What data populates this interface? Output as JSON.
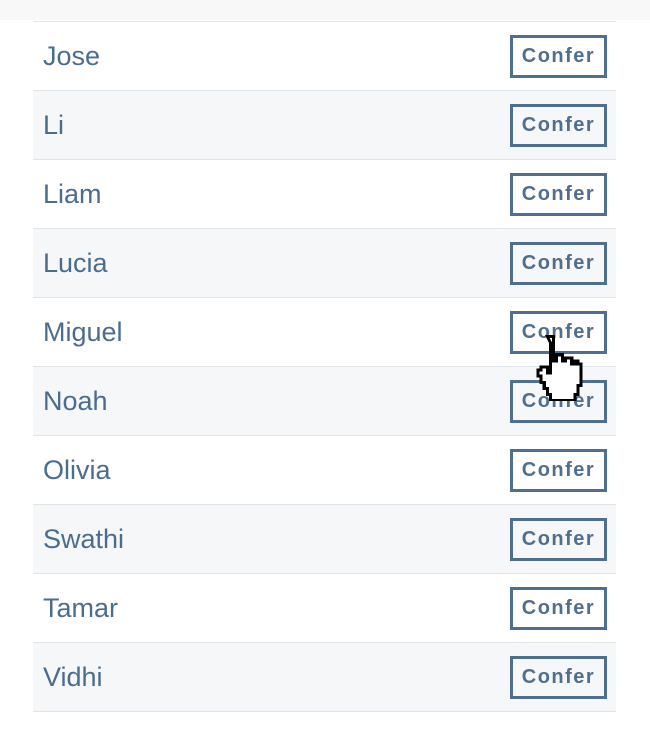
{
  "rows": [
    {
      "name": "Jose",
      "button": "Confer"
    },
    {
      "name": "Li",
      "button": "Confer"
    },
    {
      "name": "Liam",
      "button": "Confer"
    },
    {
      "name": "Lucia",
      "button": "Confer"
    },
    {
      "name": "Miguel",
      "button": "Confer"
    },
    {
      "name": "Noah",
      "button": "Confer"
    },
    {
      "name": "Olivia",
      "button": "Confer"
    },
    {
      "name": "Swathi",
      "button": "Confer"
    },
    {
      "name": "Tamar",
      "button": "Confer"
    },
    {
      "name": "Vidhi",
      "button": "Confer"
    }
  ],
  "colors": {
    "accent": "#4f6f8f",
    "text": "#4a6d8e",
    "row_alt": "#f5f7f9"
  }
}
